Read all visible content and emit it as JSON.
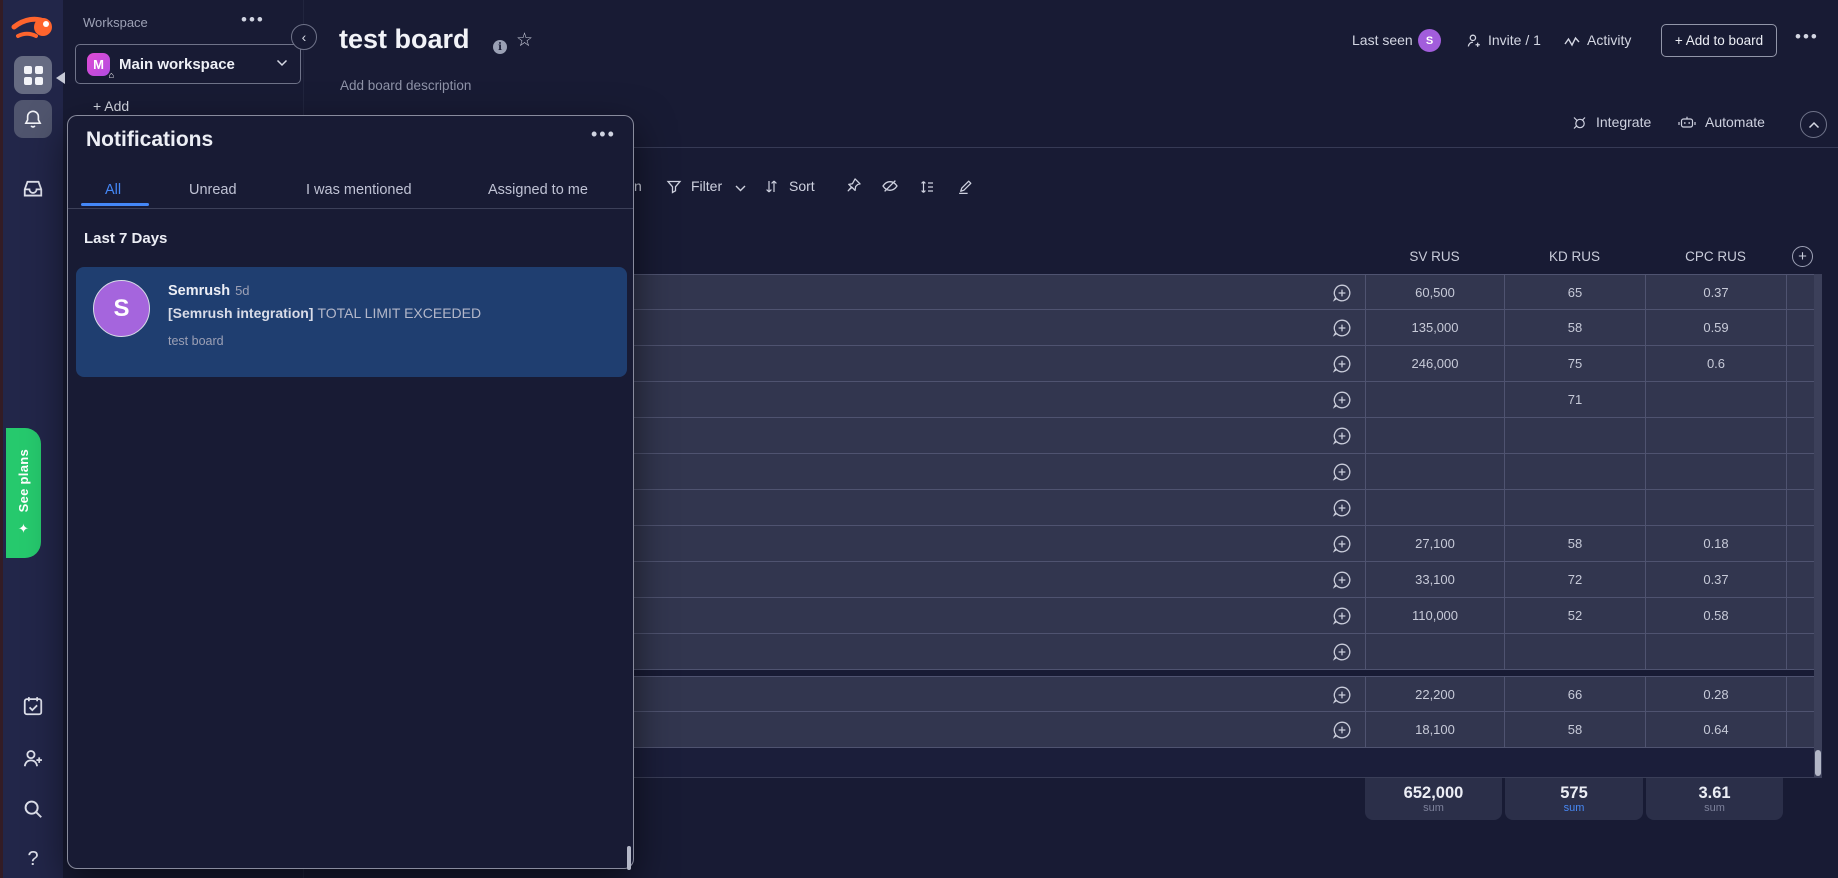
{
  "colors": {
    "accent_blue": "#4487f6",
    "purple": "#a25ddc",
    "green": "#26c96d",
    "card_blue": "#1f3e70",
    "orange_logo": "#ff642d"
  },
  "sidebar": {
    "workspace_label": "Workspace",
    "workspace_name": "Main workspace",
    "workspace_initial": "M",
    "add_truncated": "+ Add",
    "see_plans": "See plans"
  },
  "header": {
    "title": "test board",
    "description": "Add board description",
    "last_seen": "Last seen",
    "last_seen_initial": "S",
    "invite": "Invite / 1",
    "activity": "Activity",
    "add_to_board": "+ Add to board"
  },
  "board_toolbar": {
    "integrate": "Integrate",
    "automate": "Automate",
    "person_truncated": "n",
    "filter": "Filter",
    "sort": "Sort"
  },
  "notifications": {
    "title": "Notifications",
    "tabs": [
      "All",
      "Unread",
      "I was mentioned",
      "Assigned to me"
    ],
    "active_tab": "All",
    "section": "Last 7 Days",
    "item": {
      "avatar_initial": "S",
      "sender": "Semrush",
      "time": "5d",
      "tag": "[Semrush integration]",
      "message": "TOTAL LIMIT EXCEEDED",
      "board": "test board"
    }
  },
  "table": {
    "columns": [
      "SV RUS",
      "KD RUS",
      "CPC RUS"
    ],
    "groups": [
      {
        "rows": [
          {
            "sv": "60,500",
            "kd": "65",
            "cpc": "0.37"
          },
          {
            "sv": "135,000",
            "kd": "58",
            "cpc": "0.59"
          },
          {
            "sv": "246,000",
            "kd": "75",
            "cpc": "0.6"
          },
          {
            "sv": "",
            "kd": "71",
            "cpc": ""
          },
          {
            "sv": "",
            "kd": "",
            "cpc": ""
          },
          {
            "sv": "",
            "kd": "",
            "cpc": ""
          },
          {
            "sv": "",
            "kd": "",
            "cpc": ""
          },
          {
            "sv": "27,100",
            "kd": "58",
            "cpc": "0.18"
          },
          {
            "sv": "33,100",
            "kd": "72",
            "cpc": "0.37"
          },
          {
            "sv": "110,000",
            "kd": "52",
            "cpc": "0.58"
          },
          {
            "sv": "",
            "kd": "",
            "cpc": ""
          }
        ]
      },
      {
        "rows": [
          {
            "sv": "22,200",
            "kd": "66",
            "cpc": "0.28"
          },
          {
            "sv": "18,100",
            "kd": "58",
            "cpc": "0.64"
          }
        ]
      }
    ],
    "footer": {
      "sv": "652,000",
      "kd": "575",
      "cpc": "3.61",
      "sum_label": "sum"
    }
  },
  "icons": {
    "rail": [
      "semrush-logo",
      "apps-grid-icon",
      "bell-icon",
      "inbox-icon",
      "my-work-icon",
      "invite-icon",
      "search-icon",
      "help-icon"
    ],
    "header": [
      "info-icon",
      "star-icon",
      "invite-icon",
      "activity-icon",
      "ellipsis-icon"
    ],
    "toolbar": [
      "filter-icon",
      "chevron-down-icon",
      "sort-icon",
      "pin-icon",
      "hide-icon",
      "row-height-icon",
      "customize-icon"
    ],
    "board": [
      "integrate-icon",
      "automate-icon",
      "collapse-up-icon",
      "add-column-icon",
      "add-update-icon"
    ]
  }
}
